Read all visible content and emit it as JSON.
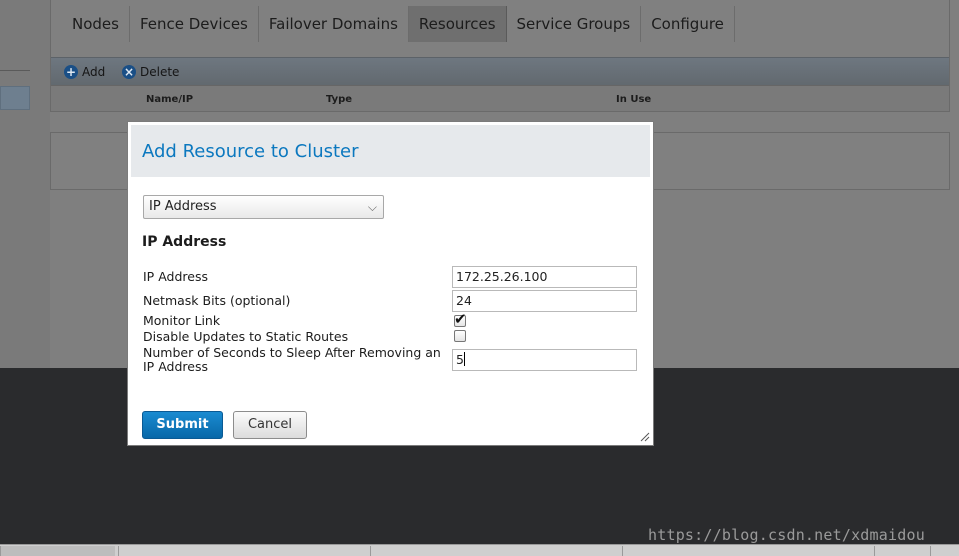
{
  "app": {
    "tabs": [
      {
        "label": "Nodes"
      },
      {
        "label": "Fence Devices"
      },
      {
        "label": "Failover Domains"
      },
      {
        "label": "Resources"
      },
      {
        "label": "Service Groups"
      },
      {
        "label": "Configure"
      }
    ],
    "active_tab": "Resources",
    "toolbar": {
      "add_label": "Add",
      "delete_label": "Delete"
    },
    "columns": [
      "Name/IP",
      "Type",
      "In Use"
    ]
  },
  "modal": {
    "title": "Add Resource to Cluster",
    "resource_type": "IP Address",
    "section_title": "IP Address",
    "fields": {
      "ip_address": {
        "label": "IP Address",
        "value": "172.25.26.100"
      },
      "netmask": {
        "label": "Netmask Bits (optional)",
        "value": "24"
      },
      "monitor_link": {
        "label": "Monitor Link",
        "checked": true
      },
      "disable_updates": {
        "label": "Disable Updates to Static Routes",
        "checked": false
      },
      "sleep_seconds": {
        "label": "Number of Seconds to Sleep After Removing an IP Address",
        "value": "5"
      }
    },
    "submit_label": "Submit",
    "cancel_label": "Cancel"
  },
  "watermark": "https://blog.csdn.net/xdmaidou",
  "colors": {
    "accent": "#0b78bf",
    "submit": "#0868a8"
  },
  "icons": {
    "add": "plus-circle-icon",
    "delete": "x-circle-icon",
    "dropdown": "chevron-down-icon",
    "resize": "resize-grip-icon"
  }
}
